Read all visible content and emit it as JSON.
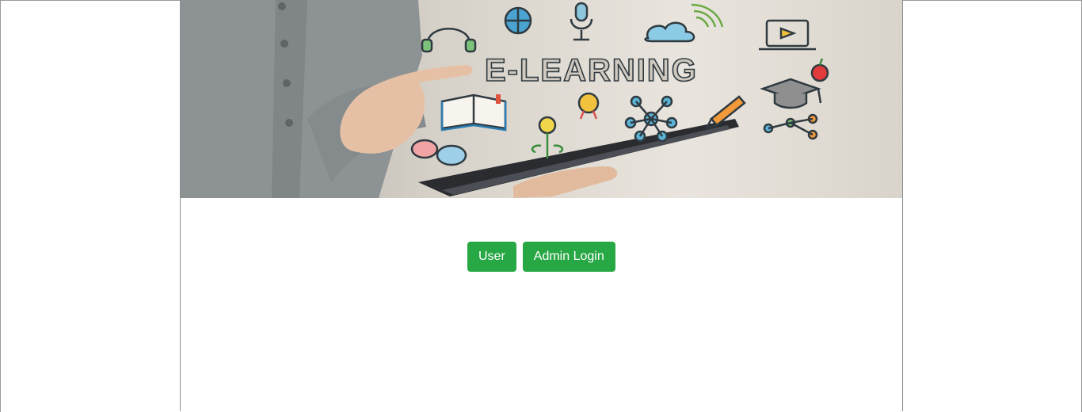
{
  "hero": {
    "banner_text": "E-LEARNING"
  },
  "buttons": {
    "user_label": "User",
    "admin_login_label": "Admin Login"
  },
  "colors": {
    "button_green": "#28a745",
    "page_background": "#ffffff"
  }
}
